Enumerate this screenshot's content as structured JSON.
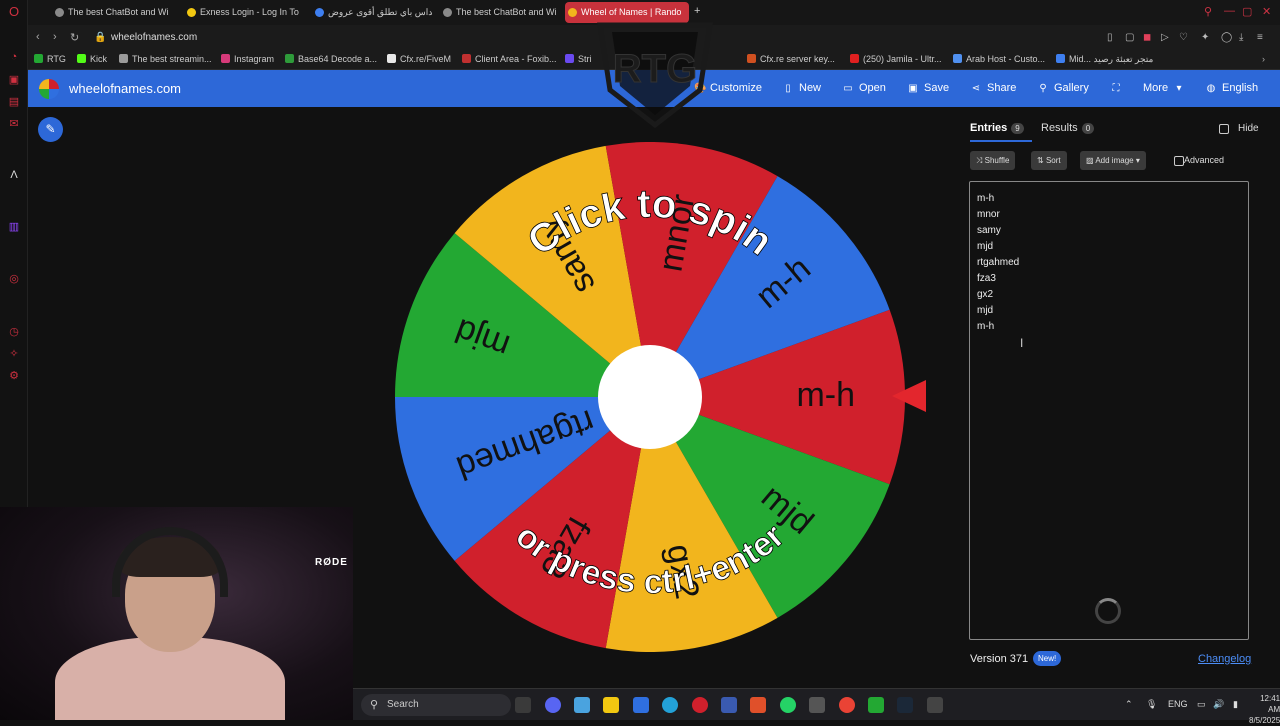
{
  "browser": {
    "tabs": [
      {
        "title": "The best ChatBot and Wi",
        "color": "#8a8a8a"
      },
      {
        "title": "Exness Login - Log In To",
        "color": "#f2c811"
      },
      {
        "title": "ميداس باي تطلق أقوى عروض",
        "color": "#3e7ff0"
      },
      {
        "title": "The best ChatBot and Wi",
        "color": "#8a8a8a"
      },
      {
        "title": "Wheel of Names | Rando",
        "color": "#f2b51d"
      }
    ],
    "url": "wheelofnames.com",
    "bookmarks": [
      {
        "label": "RTG",
        "color": "#23a833"
      },
      {
        "label": "Kick",
        "color": "#53fc18"
      },
      {
        "label": "The best streamin...",
        "color": "#9b9b9b"
      },
      {
        "label": "Instagram",
        "color": "#d63a7a"
      },
      {
        "label": "Base64 Decode a...",
        "color": "#2e9b3a"
      },
      {
        "label": "Cfx.re/FiveM",
        "color": "#e8e8e8"
      },
      {
        "label": "Client Area - Foxib...",
        "color": "#c03030"
      },
      {
        "label": "Stri",
        "color": "#6a4af0"
      },
      {
        "label": "Cfx.re server key...",
        "color": "#d05020"
      },
      {
        "label": "(250) Jamila - Ultr...",
        "color": "#e02020"
      },
      {
        "label": "Arab Host - Custo...",
        "color": "#5090f0"
      },
      {
        "label": "Mid... متجر تعبئة رصيد",
        "color": "#3e7ff0"
      }
    ]
  },
  "site": {
    "title": "wheelofnames.com",
    "menu": [
      {
        "label": "Customize",
        "icon": "palette-icon",
        "glyph": "🎨"
      },
      {
        "label": "New",
        "icon": "file-icon",
        "glyph": "▯"
      },
      {
        "label": "Open",
        "icon": "folder-icon",
        "glyph": "▭"
      },
      {
        "label": "Save",
        "icon": "save-icon",
        "glyph": "▣"
      },
      {
        "label": "Share",
        "icon": "share-icon",
        "glyph": "⋖"
      },
      {
        "label": "Gallery",
        "icon": "search-icon",
        "glyph": "⚲"
      },
      {
        "label": "",
        "icon": "fullscreen-icon",
        "glyph": "⛶"
      },
      {
        "label": "More",
        "icon": "chevron-down-icon",
        "glyph": "▾"
      },
      {
        "label": "English",
        "icon": "globe-icon",
        "glyph": "◍"
      }
    ]
  },
  "wheel": {
    "center_text_top": "Click to spin",
    "center_text_bottom": "or press ctrl+enter",
    "segments": [
      {
        "label": "m-h",
        "color": "#d0202c"
      },
      {
        "label": "mjd",
        "color": "#23a833"
      },
      {
        "label": "gx2",
        "color": "#f2b51d"
      },
      {
        "label": "fza3",
        "color": "#d0202c"
      },
      {
        "label": "rtgahmed",
        "color": "#2f6fe0"
      },
      {
        "label": "mjd",
        "color": "#23a833"
      },
      {
        "label": "samy",
        "color": "#f2b51d"
      },
      {
        "label": "mnor",
        "color": "#d0202c"
      },
      {
        "label": "m-h",
        "color": "#2f6fe0"
      }
    ]
  },
  "panel": {
    "entries_tab": "Entries",
    "entries_count": "9",
    "results_tab": "Results",
    "results_count": "0",
    "hide_label": "Hide",
    "shuffle_label": "Shuffle",
    "sort_label": "Sort",
    "add_image_label": "Add image",
    "advanced_label": "Advanced",
    "entries": [
      "m-h",
      "mnor",
      "samy",
      "mjd",
      "rtgahmed",
      "fza3",
      "gx2",
      "mjd",
      "m-h"
    ],
    "version": "Version 371",
    "new_badge": "New!",
    "changelog": "Changelog"
  },
  "webcam": {
    "mic_brand": "RØDE"
  },
  "taskbar": {
    "search_placeholder": "Search",
    "lang": "ENG",
    "time": "12:41 AM",
    "date": "8/5/2025"
  }
}
